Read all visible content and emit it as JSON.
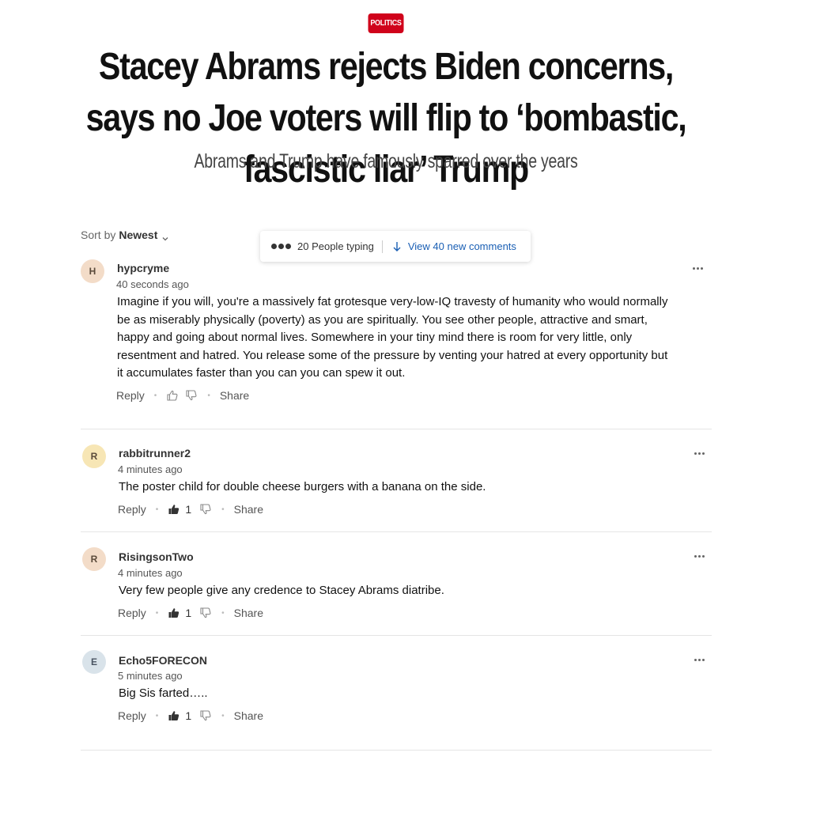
{
  "article": {
    "category": "POLITICS",
    "headline": "Stacey Abrams rejects Biden concerns, says no Joe voters will flip to ‘bombastic, fascistic liar’ Trump",
    "subheadline": "Abrams and Trump have famously sparred over the years"
  },
  "comments_section": {
    "sort_label": "Sort by",
    "sort_value": "Newest",
    "typing_text": "20 People typing",
    "new_comments_text": "View 40 new comments",
    "comments": [
      {
        "avatar_letter": "H",
        "avatar_color": "#f3dcc8",
        "username": "hypcryme",
        "time": "40 seconds ago",
        "text": "Imagine if you will, you're a massively fat grotesque very-low-IQ travesty of humanity who would normally be as miserably physically (poverty) as you are spiritually.  You see other people, attractive and smart, happy and going about normal lives.  Somewhere in your tiny mind there is room for very little, only resentment and hatred.  You release some of the pressure by venting your hatred at every opportunity but it accumulates faster than you can you can spew it out.",
        "reply_label": "Reply",
        "likes": "",
        "share_label": "Share"
      },
      {
        "avatar_letter": "R",
        "avatar_color": "#f7e6b5",
        "username": "rabbitrunner2",
        "time": "4 minutes ago",
        "text": "The poster child for double cheese burgers with a banana on the side.",
        "reply_label": "Reply",
        "likes": "1",
        "share_label": "Share"
      },
      {
        "avatar_letter": "R",
        "avatar_color": "#f3dcc8",
        "username": "RisingsonTwo",
        "time": "4 minutes ago",
        "text": "Very few people give any credence to Stacey Abrams diatribe.",
        "reply_label": "Reply",
        "likes": "1",
        "share_label": "Share"
      },
      {
        "avatar_letter": "E",
        "avatar_color": "#d9e3ea",
        "username": "Echo5FORECON",
        "time": "5 minutes ago",
        "text": "Big Sis farted…..",
        "reply_label": "Reply",
        "likes": "1",
        "share_label": "Share"
      }
    ]
  },
  "icons": {
    "more": "more-options-icon",
    "like": "thumbs-up-icon",
    "dislike": "thumbs-down-icon",
    "arrow": "arrow-down-icon",
    "typing": "typing-dots-icon",
    "chevron": "chevron-down-icon"
  },
  "colors": {
    "badge": "#d0021b",
    "link": "#1a5fb4"
  }
}
